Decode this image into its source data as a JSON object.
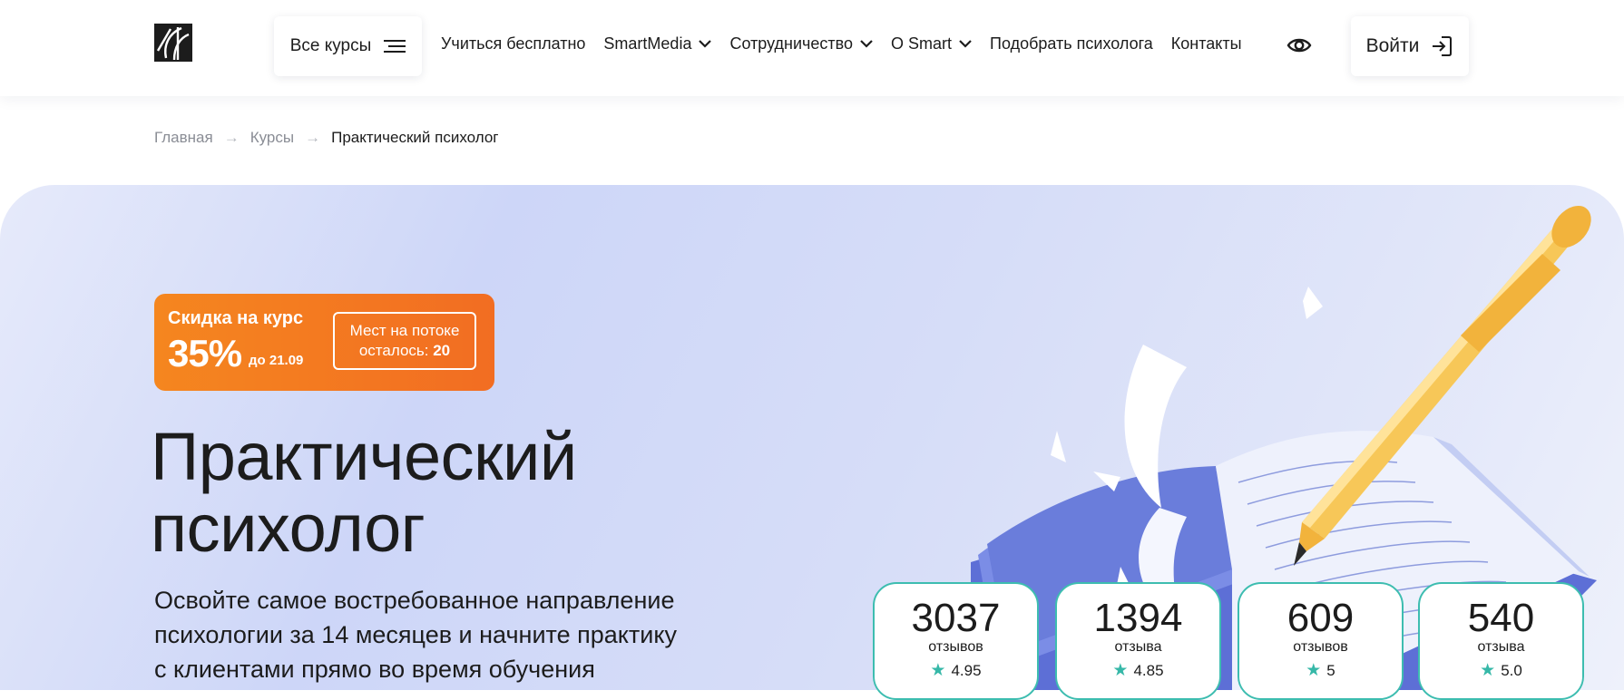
{
  "header": {
    "courses_label": "Все курсы",
    "nav": [
      {
        "label": "Учиться бесплатно",
        "dropdown": false
      },
      {
        "label": "SmartMedia",
        "dropdown": true
      },
      {
        "label": "Сотрудничество",
        "dropdown": true
      },
      {
        "label": "О Smart",
        "dropdown": true
      },
      {
        "label": "Подобрать психолога",
        "dropdown": false
      },
      {
        "label": "Контакты",
        "dropdown": false
      }
    ],
    "accessibility_icon": "eye-icon",
    "login_label": "Войти",
    "login_icon": "login-arrow-icon"
  },
  "breadcrumb": {
    "items": [
      "Главная",
      "Курсы",
      "Практический психолог"
    ],
    "separator": "→"
  },
  "promo": {
    "label": "Скидка на курс",
    "percent": "35%",
    "until": "до 21.09",
    "seats_line1": "Мест на потоке",
    "seats_prefix": "осталось: ",
    "seats_count": "20"
  },
  "hero": {
    "title_line1": "Практический",
    "title_line2": "психолог",
    "subtitle_line1": "Освойте самое востребованное направление",
    "subtitle_line2": "психологии за 14 месяцев и начните практику",
    "subtitle_line3": "с клиентами прямо во время обучения"
  },
  "stats": [
    {
      "count": "3037",
      "word": "отзывов",
      "rating": "4.95"
    },
    {
      "count": "1394",
      "word": "отзыва",
      "rating": "4.85"
    },
    {
      "count": "609",
      "word": "отзывов",
      "rating": "5"
    },
    {
      "count": "540",
      "word": "отзыва",
      "rating": "5.0"
    }
  ],
  "colors": {
    "accent_orange": "#f26d22",
    "accent_teal": "#3dbdb0",
    "hero_background": "#d3dbf8"
  }
}
